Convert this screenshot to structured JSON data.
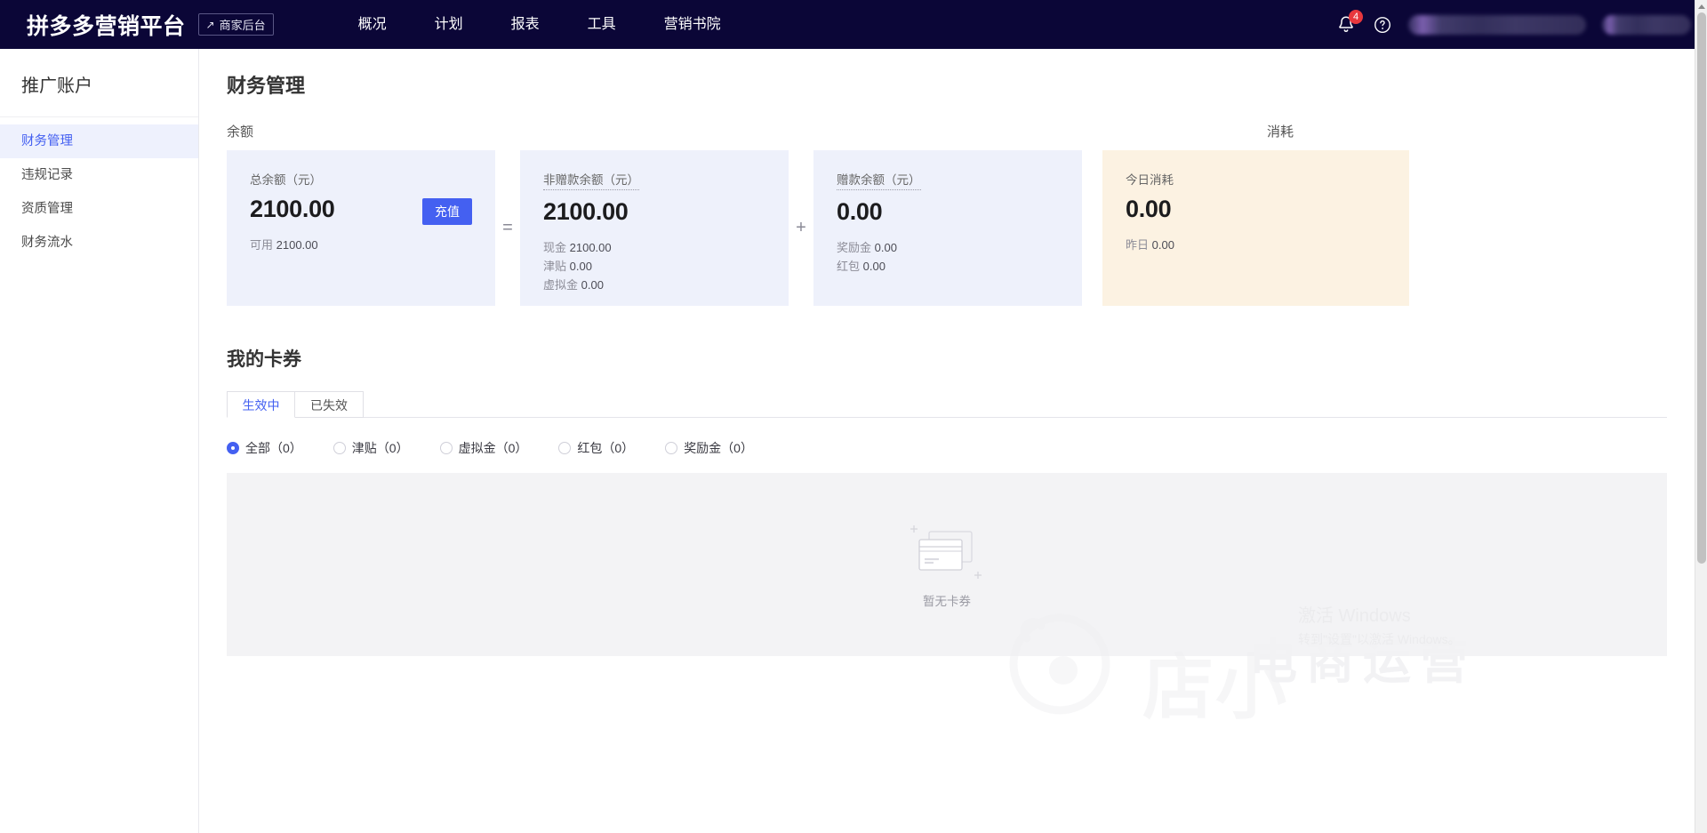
{
  "header": {
    "brand": "拼多多营销平台",
    "merchant_badge": {
      "label": "商家后台",
      "icon": "external-link-icon"
    },
    "nav": [
      {
        "label": "概况"
      },
      {
        "label": "计划"
      },
      {
        "label": "报表"
      },
      {
        "label": "工具"
      },
      {
        "label": "营销书院"
      }
    ],
    "notification": {
      "icon": "bell-icon",
      "count": "4"
    },
    "help": {
      "icon": "question-circle-icon"
    }
  },
  "sidebar": {
    "title": "推广账户",
    "items": [
      {
        "label": "财务管理",
        "active": true
      },
      {
        "label": "违规记录",
        "active": false
      },
      {
        "label": "资质管理",
        "active": false
      },
      {
        "label": "财务流水",
        "active": false
      }
    ]
  },
  "main": {
    "page_title": "财务管理",
    "balance_label": "余额",
    "spend_label": "消耗",
    "operators": {
      "equals": "=",
      "plus": "+"
    },
    "cards": {
      "total": {
        "label": "总余额（元）",
        "amount": "2100.00",
        "sub_label": "可用",
        "sub_value": "2100.00",
        "button": "充值"
      },
      "non_gift": {
        "label": "非赠款余额（元）",
        "amount": "2100.00",
        "rows": [
          {
            "name": "现金",
            "value": "2100.00"
          },
          {
            "name": "津贴",
            "value": "0.00"
          },
          {
            "name": "虚拟金",
            "value": "0.00"
          }
        ]
      },
      "gift": {
        "label": "赠款余额（元）",
        "amount": "0.00",
        "rows": [
          {
            "name": "奖励金",
            "value": "0.00"
          },
          {
            "name": "红包",
            "value": "0.00"
          }
        ]
      },
      "spend": {
        "label": "今日消耗",
        "amount": "0.00",
        "sub_label": "昨日",
        "sub_value": "0.00"
      }
    },
    "coupons": {
      "title": "我的卡券",
      "tabs": [
        {
          "label": "生效中",
          "active": true
        },
        {
          "label": "已失效",
          "active": false
        }
      ],
      "filters": [
        {
          "label": "全部（0）",
          "checked": true
        },
        {
          "label": "津贴（0）",
          "checked": false
        },
        {
          "label": "虚拟金（0）",
          "checked": false
        },
        {
          "label": "红包（0）",
          "checked": false
        },
        {
          "label": "奖励金（0）",
          "checked": false
        }
      ],
      "empty_text": "暂无卡券"
    }
  },
  "watermark": {
    "brand_cn": "店小",
    "sub_text": "电商运营",
    "windows_line1": "激活 Windows",
    "windows_line2": "转到\"设置\"以激活 Windows。"
  },
  "colors": {
    "header_bg": "#0b0637",
    "accent": "#4460f1",
    "card_blue": "#eef1fb",
    "card_cream": "#fcf2e2",
    "badge_red": "#e8373d",
    "empty_bg": "#f3f3f5"
  }
}
